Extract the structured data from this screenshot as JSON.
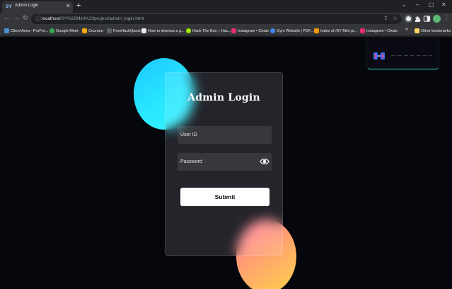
{
  "browser": {
    "tab": {
      "favicon_text": "SY",
      "title": "Admin Login",
      "close_glyph": "×"
    },
    "new_tab_glyph": "+",
    "window_controls": {
      "dropdown": "⌄",
      "minimize": "–",
      "maximize": "▢",
      "close": "✕"
    },
    "nav": {
      "back": "←",
      "forward": "→",
      "reload": "↻"
    },
    "omnibox": {
      "host": "localhost",
      "path": "/SY%20Mini%20project/admin_login.html",
      "info_glyph": "ⓘ",
      "share_glyph": "⇪",
      "star_glyph": "☆"
    },
    "menu_glyph": "⋮",
    "bookmarks": [
      {
        "label": "Client Area - ProFre...",
        "icon": "bookmark-icon",
        "color": "#4a90d9"
      },
      {
        "label": "Google Meet",
        "icon": "google-meet-icon",
        "color": "#34a853"
      },
      {
        "label": "Courses",
        "icon": "courses-icon",
        "color": "#f9ab00"
      },
      {
        "label": "FreeHackQuest",
        "icon": "freehackquest-icon",
        "color": "#9aa0a6"
      },
      {
        "label": "How to impress a g...",
        "icon": "page-icon",
        "color": "#e8eaed"
      },
      {
        "label": "Hack The Box :: Hac...",
        "icon": "hackthebox-icon",
        "color": "#9fef00"
      },
      {
        "label": "Instagram • Chats",
        "icon": "instagram-icon",
        "color": "#e1306c"
      },
      {
        "label": "Gym Website | PDF...",
        "icon": "gym-icon",
        "color": "#4285f4"
      },
      {
        "label": "Index of /SY Mini pr...",
        "icon": "folder-index-icon",
        "color": "#f29900"
      },
      {
        "label": "Instagram • Chats",
        "icon": "instagram-icon",
        "color": "#e1306c"
      }
    ],
    "bookmarks_overflow_glyph": "»",
    "other_bookmarks": {
      "label": "Other bookmarks",
      "icon": "folder-icon",
      "color": "#fdd663"
    }
  },
  "login": {
    "title": "Admin Login",
    "user_id_placeholder": "User ID",
    "password_placeholder": "Password",
    "submit_label": "Submit"
  },
  "colors": {
    "page_background": "#06060d",
    "accent_blue": "#27e6ff",
    "accent_orange": "#ffa170",
    "button_background": "#ffffff"
  }
}
